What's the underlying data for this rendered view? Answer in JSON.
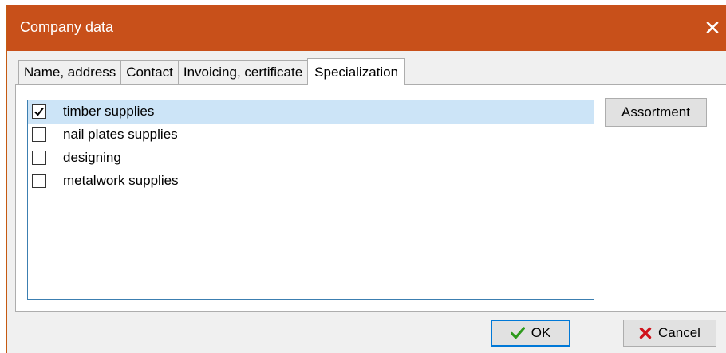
{
  "window": {
    "title": "Company data",
    "close_icon": "close-icon"
  },
  "tabs": [
    {
      "label": "Name, address",
      "active": false
    },
    {
      "label": "Contact",
      "active": false
    },
    {
      "label": "Invoicing, certificate",
      "active": false
    },
    {
      "label": "Specialization",
      "active": true
    }
  ],
  "specializations": [
    {
      "label": "timber supplies",
      "checked": true,
      "selected": true
    },
    {
      "label": "nail plates supplies",
      "checked": false,
      "selected": false
    },
    {
      "label": "designing",
      "checked": false,
      "selected": false
    },
    {
      "label": "metalwork supplies",
      "checked": false,
      "selected": false
    }
  ],
  "buttons": {
    "assortment": "Assortment",
    "ok": "OK",
    "cancel": "Cancel"
  },
  "colors": {
    "titlebar": "#c8501a",
    "ok_icon": "#2e9a1c",
    "cancel_icon": "#d0121b",
    "selection": "#cce4f7"
  }
}
